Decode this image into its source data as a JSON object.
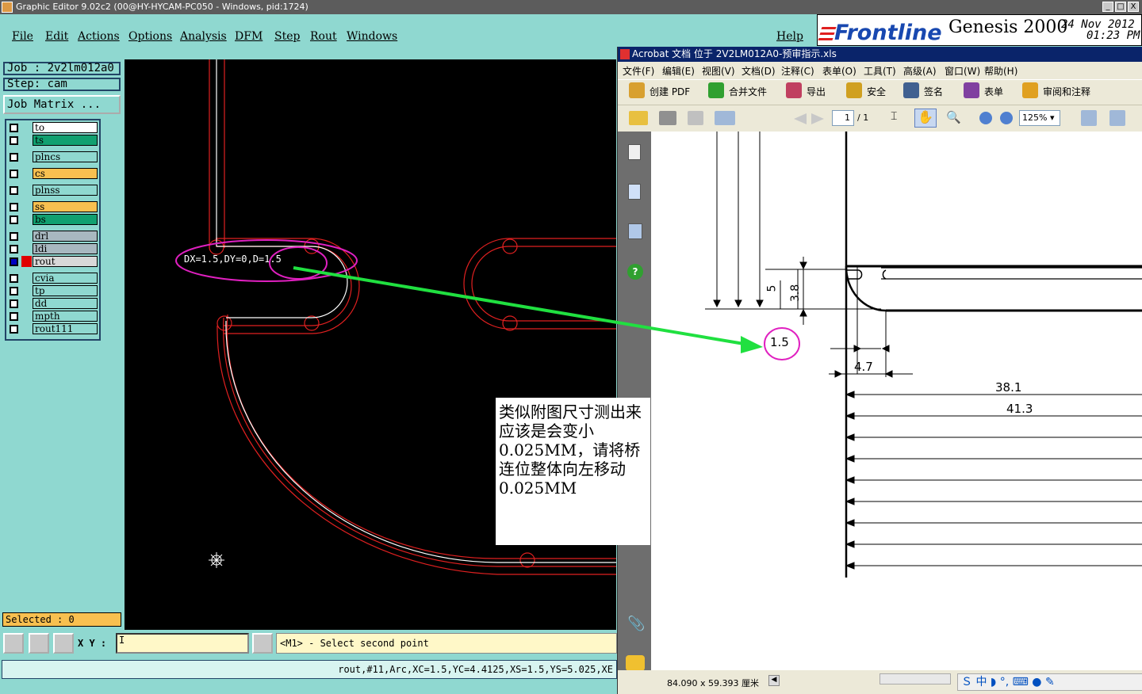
{
  "window": {
    "title": "Graphic Editor 9.02c2 (00@HY-HYCAM-PC050 - Windows, pid:1724)",
    "controls": [
      "_",
      "□",
      "X"
    ]
  },
  "menu": {
    "items": [
      "File",
      "Edit",
      "Actions",
      "Options",
      "Analysis",
      "DFM",
      "Step",
      "Rout",
      "Windows"
    ],
    "help": "Help"
  },
  "brand": {
    "logo": "Frontline",
    "product": "Genesis 2000",
    "date": "24 Nov 2012",
    "time": "01:23 PM"
  },
  "job": {
    "job_label": "Job : 2v2lm012a0",
    "step_label": "Step: cam",
    "matrix_button": "Job Matrix ..."
  },
  "layers": [
    {
      "name": "to",
      "color": "#ffffff"
    },
    {
      "name": "ts",
      "color": "#11a070"
    },
    {
      "name": "plncs",
      "color": "#8fd8d0"
    },
    {
      "name": "cs",
      "color": "#f8c050"
    },
    {
      "name": "plnss",
      "color": "#8fd8d0"
    },
    {
      "name": "ss",
      "color": "#f8c050"
    },
    {
      "name": "bs",
      "color": "#11a070"
    },
    {
      "name": "drl",
      "color": "#a8b8c0"
    },
    {
      "name": "ldi",
      "color": "#a8b8c0"
    },
    {
      "name": "rout",
      "color": "#d8d8d8"
    },
    {
      "name": "cvia",
      "color": "#8fd8d0"
    },
    {
      "name": "tp",
      "color": "#8fd8d0"
    },
    {
      "name": "dd",
      "color": "#8fd8d0"
    },
    {
      "name": "mpth",
      "color": "#8fd8d0"
    },
    {
      "name": "rout111",
      "color": "#8fd8d0"
    }
  ],
  "selected": "Selected : 0",
  "canvas": {
    "measure_text": "DX=1.5,DY=0,D=1.5"
  },
  "bottom": {
    "xy_label": "X Y :",
    "xy_value": "I",
    "prompt": "<M1> - Select second point",
    "status": "rout,#11,Arc,XC=1.5,YC=4.4125,XS=1.5,YS=5.025,XE"
  },
  "acrobat": {
    "title": "Acrobat 文档 位于 2V2LM012A0-预审指示.xls",
    "menu": [
      "文件(F)",
      "编辑(E)",
      "视图(V)",
      "文档(D)",
      "注释(C)",
      "表单(O)",
      "工具(T)",
      "高级(A)",
      "窗口(W)",
      "帮助(H)"
    ],
    "toolbar": [
      "创建 PDF",
      "合并文件",
      "导出",
      "安全",
      "签名",
      "表单",
      "审阅和注释"
    ],
    "page": "1",
    "page_total": "/ 1",
    "zoom": "125%",
    "page_size": "84.090 x 59.393 厘米",
    "dims": {
      "d5": "5",
      "d38": "3.8",
      "d15": "1.5",
      "d47": "4.7",
      "d381": "38.1",
      "d413": "41.3"
    }
  },
  "note": "类似附图尺寸测出来应该是会变小0.025MM，请将桥连位整体向左移动0.025MM",
  "colors": {
    "accent_red": "#e02020",
    "highlight_magenta": "#e020c0",
    "arrow_green": "#20e040"
  }
}
